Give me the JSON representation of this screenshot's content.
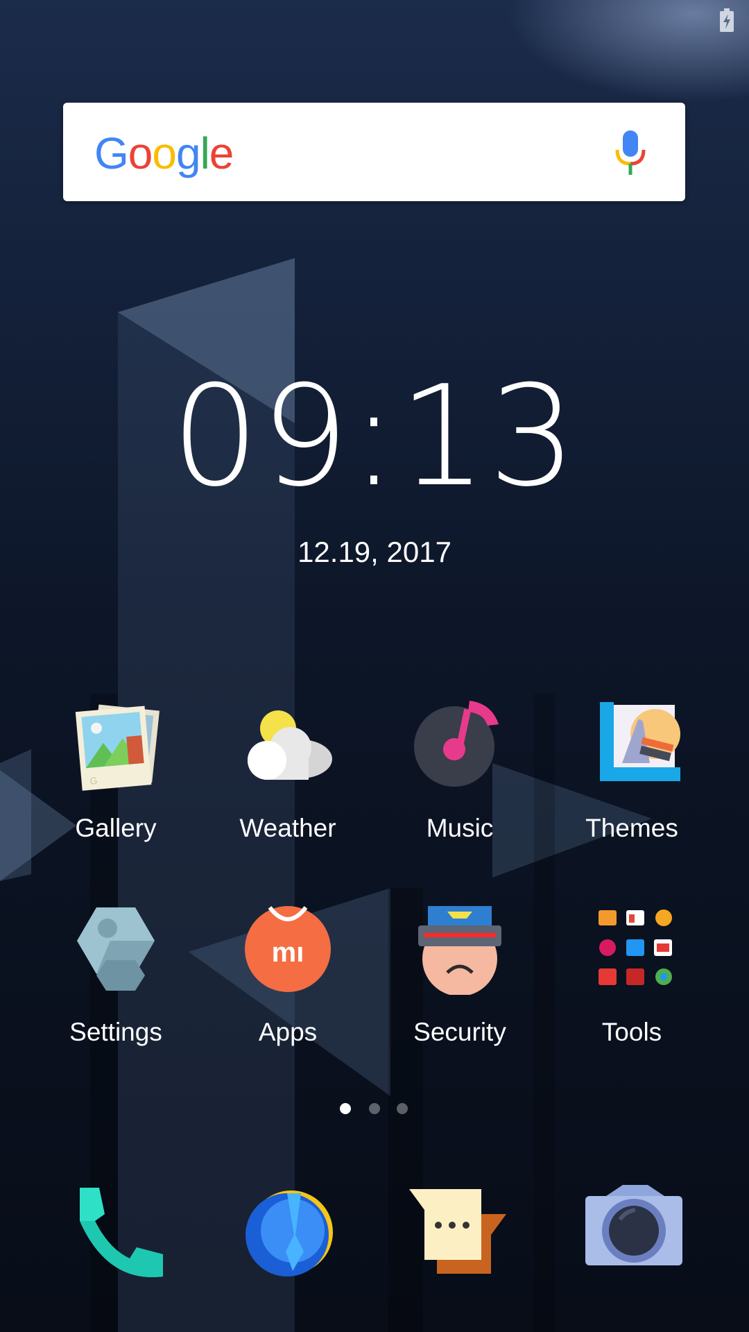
{
  "search": {
    "logo_text": "Google"
  },
  "clock": {
    "time": "09:13",
    "date": "12.19, 2017"
  },
  "apps": {
    "row1": [
      {
        "label": "Gallery",
        "icon": "gallery-icon"
      },
      {
        "label": "Weather",
        "icon": "weather-icon"
      },
      {
        "label": "Music",
        "icon": "music-icon"
      },
      {
        "label": "Themes",
        "icon": "themes-icon"
      }
    ],
    "row2": [
      {
        "label": "Settings",
        "icon": "settings-icon"
      },
      {
        "label": "Apps",
        "icon": "mi-apps-icon"
      },
      {
        "label": "Security",
        "icon": "security-icon"
      },
      {
        "label": "Tools",
        "icon": "tools-folder-icon"
      }
    ]
  },
  "apps_logo_text": "mı",
  "pages": {
    "count": 3,
    "active": 1
  },
  "dock": [
    {
      "icon": "phone-icon"
    },
    {
      "icon": "browser-icon"
    },
    {
      "icon": "messages-icon"
    },
    {
      "icon": "camera-icon"
    }
  ],
  "colors": {
    "google_blue": "#4285F4",
    "google_red": "#EA4335",
    "google_yellow": "#FBBC05",
    "google_green": "#34A853"
  }
}
